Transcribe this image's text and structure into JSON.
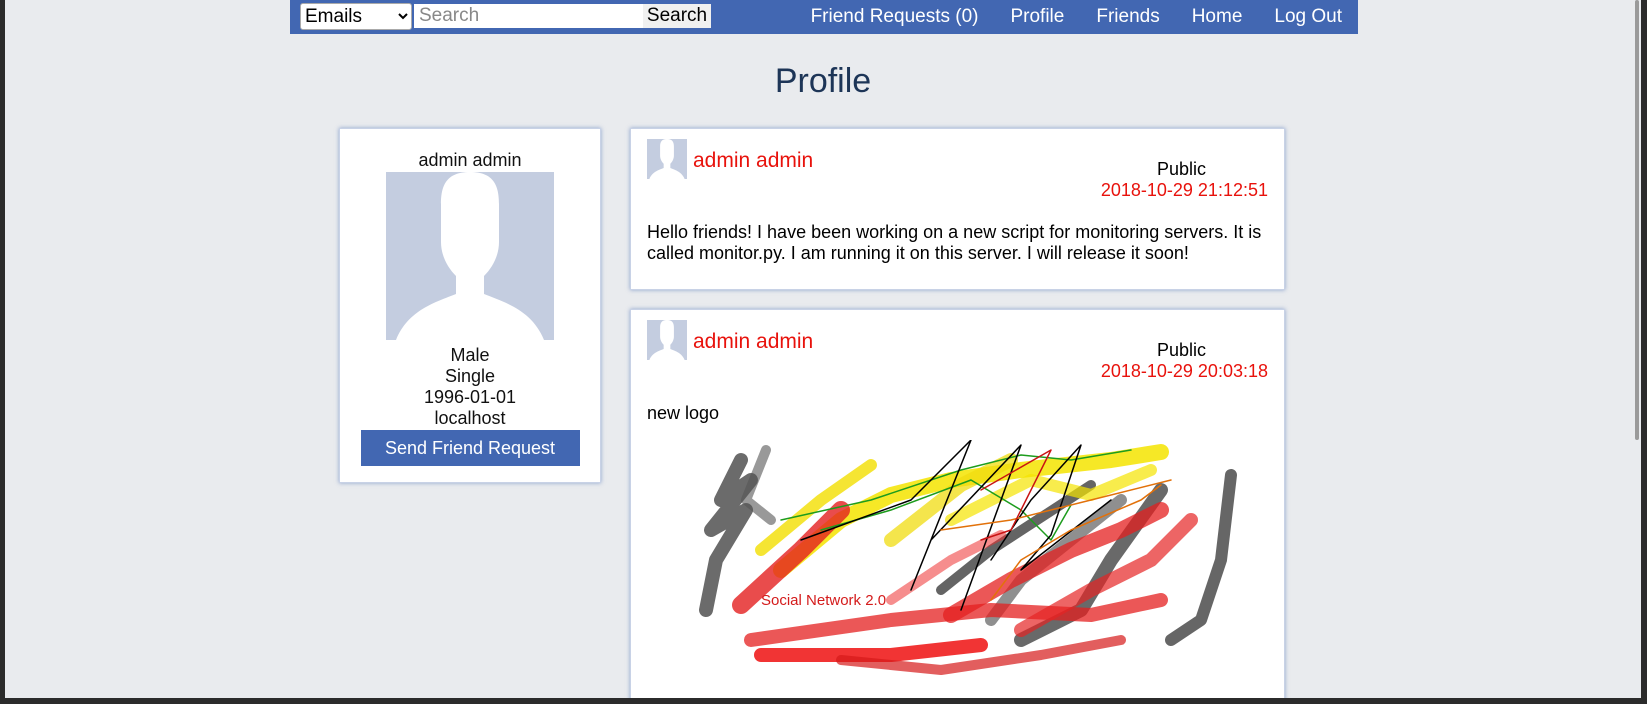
{
  "topbar": {
    "search_type_options": [
      "Emails"
    ],
    "search_type_selected": "Emails",
    "search_placeholder": "Search",
    "search_button": "Search",
    "nav": {
      "friend_requests": "Friend Requests (0)",
      "profile": "Profile",
      "friends": "Friends",
      "home": "Home",
      "logout": "Log Out"
    }
  },
  "page": {
    "title": "Profile"
  },
  "profile": {
    "name": "admin admin",
    "gender": "Male",
    "relationship": "Single",
    "birthdate": "1996-01-01",
    "location": "localhost",
    "friend_button": "Send Friend Request"
  },
  "posts": [
    {
      "author": "admin admin",
      "visibility": "Public",
      "timestamp": "2018-10-29 21:12:51",
      "body": "Hello friends! I have been working on a new script for monitoring servers. It is called monitor.py. I am running it on this server. I will release it soon!"
    },
    {
      "author": "admin admin",
      "visibility": "Public",
      "timestamp": "2018-10-29 20:03:18",
      "body": "new logo",
      "image_text": "Social Network 2.0"
    }
  ],
  "colors": {
    "brand": "#4267b2",
    "accent_red": "#e8120c",
    "background": "#e9ebee",
    "avatar_placeholder": "#c4cde0"
  }
}
